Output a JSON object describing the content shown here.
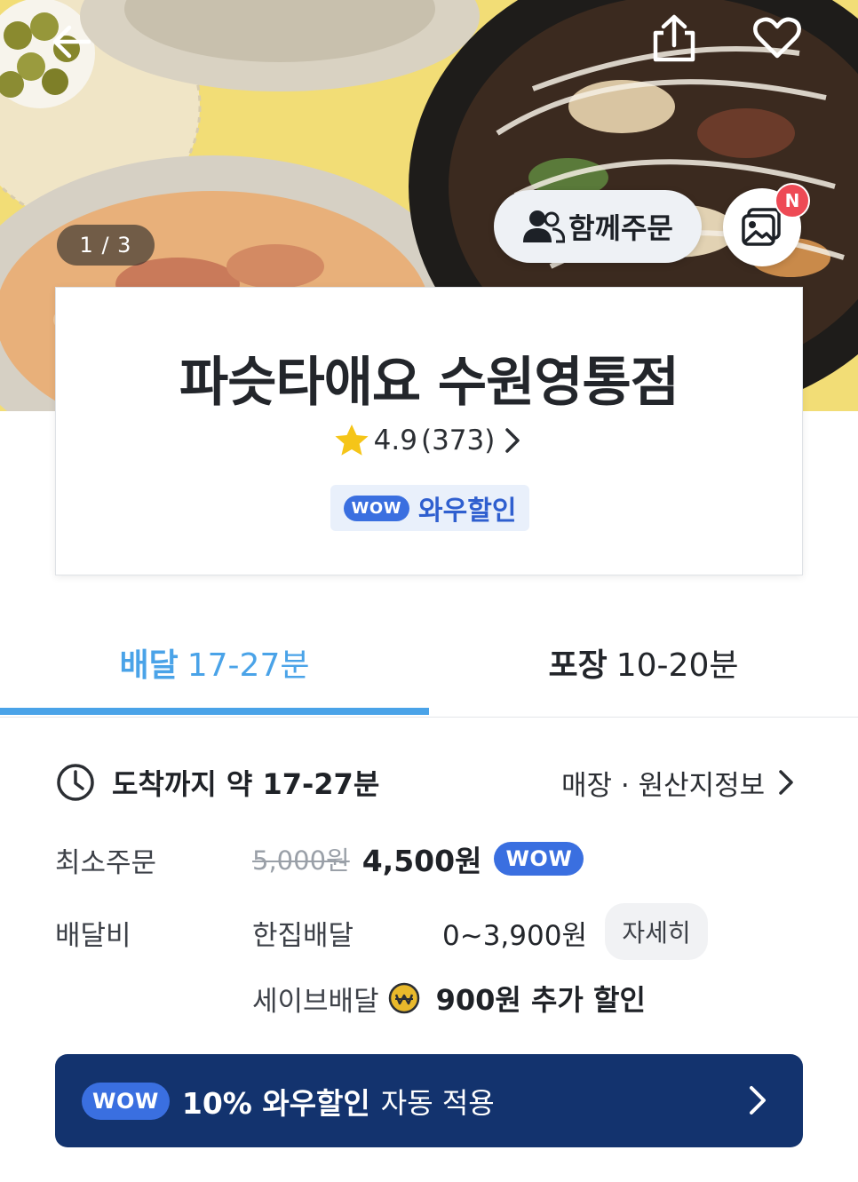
{
  "hero": {
    "page_counter": "1 / 3",
    "group_order_label": "함께주문",
    "new_badge": "N",
    "icons": {
      "back": "arrow-left-icon",
      "share": "share-icon",
      "favorite": "heart-icon",
      "group": "people-icon",
      "photos": "photo-review-icon"
    }
  },
  "store": {
    "name": "파슷타애요 수원영통점",
    "rating": "4.9",
    "review_count": "(373)",
    "wow_pill": "WOW",
    "wow_discount_label": "와우할인"
  },
  "tabs": [
    {
      "label": "배달",
      "time": "17-27분",
      "active": true
    },
    {
      "label": "포장",
      "time": "10-20분",
      "active": false
    }
  ],
  "info": {
    "eta": "도착까지 약 17-27분",
    "store_info_link": "매장 · 원산지정보",
    "min_order_label": "최소주문",
    "min_order_old": "5,000원",
    "min_order_new": "4,500원",
    "min_order_badge": "WOW",
    "delivery_fee_label": "배달비",
    "delivery_type": "한집배달",
    "delivery_fee_range": "0~3,900원",
    "detail_button": "자세히",
    "save_delivery_label": "세이브배달",
    "save_delivery_discount": "900원 추가 할인"
  },
  "wow_banner": {
    "badge": "WOW",
    "bold_text": "10% 와우할인",
    "normal_text": "자동 적용"
  },
  "colors": {
    "accent_blue": "#4aa3e8",
    "wow_blue": "#3a6fe0",
    "banner_navy": "#13336e",
    "new_badge_red": "#ee4a55",
    "star_yellow": "#f5c518"
  }
}
